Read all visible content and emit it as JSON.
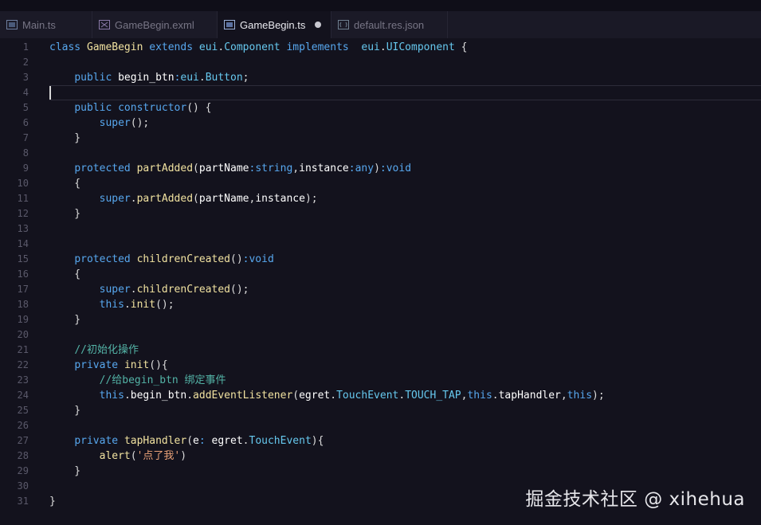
{
  "tabs": [
    {
      "label": "Main.ts",
      "icon": "typescript-file-icon",
      "active": false,
      "modified": false
    },
    {
      "label": "GameBegin.exml",
      "icon": "exml-file-icon",
      "active": false,
      "modified": false
    },
    {
      "label": "GameBegin.ts",
      "icon": "typescript-file-icon",
      "active": true,
      "modified": true
    },
    {
      "label": "default.res.json",
      "icon": "json-file-icon",
      "active": false,
      "modified": false
    }
  ],
  "editor": {
    "cursor_line": 4,
    "lines": [
      {
        "n": "1",
        "tokens": [
          [
            "kw",
            "class "
          ],
          [
            "fn",
            "GameBegin "
          ],
          [
            "kw",
            "extends "
          ],
          [
            "ty",
            "eui"
          ],
          [
            "pl",
            "."
          ],
          [
            "ty",
            "Component "
          ],
          [
            "kw",
            "implements  "
          ],
          [
            "ty",
            "eui"
          ],
          [
            "pl",
            "."
          ],
          [
            "ty",
            "UIComponent "
          ],
          [
            "pl",
            "{"
          ]
        ]
      },
      {
        "n": "2",
        "tokens": []
      },
      {
        "n": "3",
        "tokens": [
          [
            "pl",
            "    "
          ],
          [
            "kw",
            "public "
          ],
          [
            "var",
            "begin_btn"
          ],
          [
            "kw",
            ":"
          ],
          [
            "ty",
            "eui"
          ],
          [
            "pl",
            "."
          ],
          [
            "ty",
            "Button"
          ],
          [
            "pl",
            ";"
          ]
        ]
      },
      {
        "n": "4",
        "tokens": []
      },
      {
        "n": "5",
        "tokens": [
          [
            "pl",
            "    "
          ],
          [
            "kw",
            "public "
          ],
          [
            "kw",
            "constructor"
          ],
          [
            "pl",
            "() {"
          ]
        ]
      },
      {
        "n": "6",
        "tokens": [
          [
            "pl",
            "        "
          ],
          [
            "kw",
            "super"
          ],
          [
            "pl",
            "();"
          ]
        ]
      },
      {
        "n": "7",
        "tokens": [
          [
            "pl",
            "    }"
          ]
        ]
      },
      {
        "n": "8",
        "tokens": []
      },
      {
        "n": "9",
        "tokens": [
          [
            "pl",
            "    "
          ],
          [
            "kw",
            "protected "
          ],
          [
            "fn",
            "partAdded"
          ],
          [
            "pl",
            "("
          ],
          [
            "var",
            "partName"
          ],
          [
            "kw",
            ":string"
          ],
          [
            "pl",
            ","
          ],
          [
            "var",
            "instance"
          ],
          [
            "kw",
            ":any"
          ],
          [
            "pl",
            ")"
          ],
          [
            "kw",
            ":void"
          ]
        ]
      },
      {
        "n": "10",
        "tokens": [
          [
            "pl",
            "    {"
          ]
        ]
      },
      {
        "n": "11",
        "tokens": [
          [
            "pl",
            "        "
          ],
          [
            "kw",
            "super"
          ],
          [
            "pl",
            "."
          ],
          [
            "fn",
            "partAdded"
          ],
          [
            "pl",
            "("
          ],
          [
            "var",
            "partName"
          ],
          [
            "pl",
            ","
          ],
          [
            "var",
            "instance"
          ],
          [
            "pl",
            ");"
          ]
        ]
      },
      {
        "n": "12",
        "tokens": [
          [
            "pl",
            "    }"
          ]
        ]
      },
      {
        "n": "13",
        "tokens": []
      },
      {
        "n": "14",
        "tokens": []
      },
      {
        "n": "15",
        "tokens": [
          [
            "pl",
            "    "
          ],
          [
            "kw",
            "protected "
          ],
          [
            "fn",
            "childrenCreated"
          ],
          [
            "pl",
            "()"
          ],
          [
            "kw",
            ":void"
          ]
        ]
      },
      {
        "n": "16",
        "tokens": [
          [
            "pl",
            "    {"
          ]
        ]
      },
      {
        "n": "17",
        "tokens": [
          [
            "pl",
            "        "
          ],
          [
            "kw",
            "super"
          ],
          [
            "pl",
            "."
          ],
          [
            "fn",
            "childrenCreated"
          ],
          [
            "pl",
            "();"
          ]
        ]
      },
      {
        "n": "18",
        "tokens": [
          [
            "pl",
            "        "
          ],
          [
            "kw",
            "this"
          ],
          [
            "pl",
            "."
          ],
          [
            "fn",
            "init"
          ],
          [
            "pl",
            "();"
          ]
        ]
      },
      {
        "n": "19",
        "tokens": [
          [
            "pl",
            "    }"
          ]
        ]
      },
      {
        "n": "20",
        "tokens": []
      },
      {
        "n": "21",
        "tokens": [
          [
            "pl",
            "    "
          ],
          [
            "cm",
            "//初始化操作"
          ]
        ]
      },
      {
        "n": "22",
        "tokens": [
          [
            "pl",
            "    "
          ],
          [
            "kw",
            "private "
          ],
          [
            "fn",
            "init"
          ],
          [
            "pl",
            "(){"
          ]
        ]
      },
      {
        "n": "23",
        "tokens": [
          [
            "pl",
            "        "
          ],
          [
            "cm",
            "//给begin_btn 绑定事件"
          ]
        ]
      },
      {
        "n": "24",
        "tokens": [
          [
            "pl",
            "        "
          ],
          [
            "kw",
            "this"
          ],
          [
            "pl",
            "."
          ],
          [
            "var",
            "begin_btn"
          ],
          [
            "pl",
            "."
          ],
          [
            "fn",
            "addEventListener"
          ],
          [
            "pl",
            "("
          ],
          [
            "var",
            "egret"
          ],
          [
            "pl",
            "."
          ],
          [
            "ty",
            "TouchEvent"
          ],
          [
            "pl",
            "."
          ],
          [
            "ty",
            "TOUCH_TAP"
          ],
          [
            "pl",
            ","
          ],
          [
            "kw",
            "this"
          ],
          [
            "pl",
            "."
          ],
          [
            "var",
            "tapHandler"
          ],
          [
            "pl",
            ","
          ],
          [
            "kw",
            "this"
          ],
          [
            "pl",
            ");"
          ]
        ]
      },
      {
        "n": "25",
        "tokens": [
          [
            "pl",
            "    }"
          ]
        ]
      },
      {
        "n": "26",
        "tokens": []
      },
      {
        "n": "27",
        "tokens": [
          [
            "pl",
            "    "
          ],
          [
            "kw",
            "private "
          ],
          [
            "fn",
            "tapHandler"
          ],
          [
            "pl",
            "("
          ],
          [
            "var",
            "e"
          ],
          [
            "kw",
            ": "
          ],
          [
            "var",
            "egret"
          ],
          [
            "pl",
            "."
          ],
          [
            "ty",
            "TouchEvent"
          ],
          [
            "pl",
            "){"
          ]
        ]
      },
      {
        "n": "28",
        "tokens": [
          [
            "pl",
            "        "
          ],
          [
            "fn",
            "alert"
          ],
          [
            "pl",
            "("
          ],
          [
            "st",
            "'点了我'"
          ],
          [
            "pl",
            ")"
          ]
        ]
      },
      {
        "n": "29",
        "tokens": [
          [
            "pl",
            "    }"
          ]
        ]
      },
      {
        "n": "30",
        "tokens": []
      },
      {
        "n": "31",
        "tokens": [
          [
            "pl",
            "}"
          ]
        ]
      }
    ]
  },
  "watermark": "掘金技术社区 @ xihehua"
}
